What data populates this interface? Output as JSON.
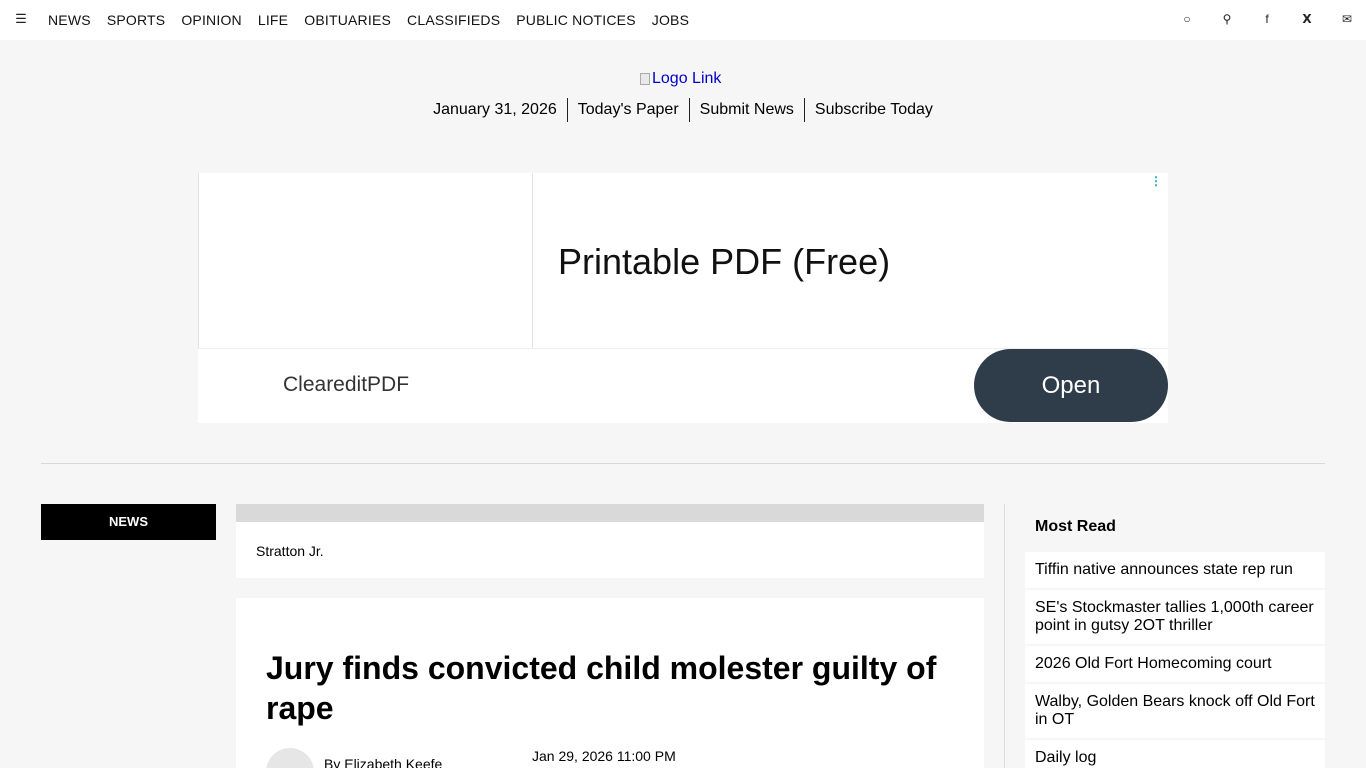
{
  "nav": {
    "menu_icon": "menu-icon",
    "links": [
      "NEWS",
      "SPORTS",
      "OPINION",
      "LIFE",
      "OBITUARIES",
      "CLASSIFIEDS",
      "PUBLIC NOTICES",
      "JOBS"
    ],
    "right_icons": [
      "account-icon",
      "search-icon",
      "facebook-icon",
      "twitter-icon",
      "mail-icon"
    ]
  },
  "masthead": {
    "logo_alt": "Logo Link",
    "date": "January 31, 2026",
    "links": [
      "Today's Paper",
      "Submit News",
      "Subscribe Today"
    ]
  },
  "ad": {
    "headline": "Printable PDF (Free)",
    "brand": "CleareditPDF",
    "cta": "Open"
  },
  "section": {
    "label": "NEWS"
  },
  "caption": {
    "text": "Stratton Jr."
  },
  "article": {
    "headline": "Jury finds convicted child molester guilty of rape",
    "byline": "By Elizabeth Keefe",
    "date": "Jan 29, 2026 11:00 PM"
  },
  "sidebar": {
    "title": "Most Read",
    "items": [
      "Tiffin native announces state rep run",
      "SE's Stockmaster tallies 1,000th career point in gutsy 2OT thriller",
      "2026 Old Fort Homecoming court",
      "Walby, Golden Bears knock off Old Fort in OT",
      "Daily log"
    ]
  }
}
